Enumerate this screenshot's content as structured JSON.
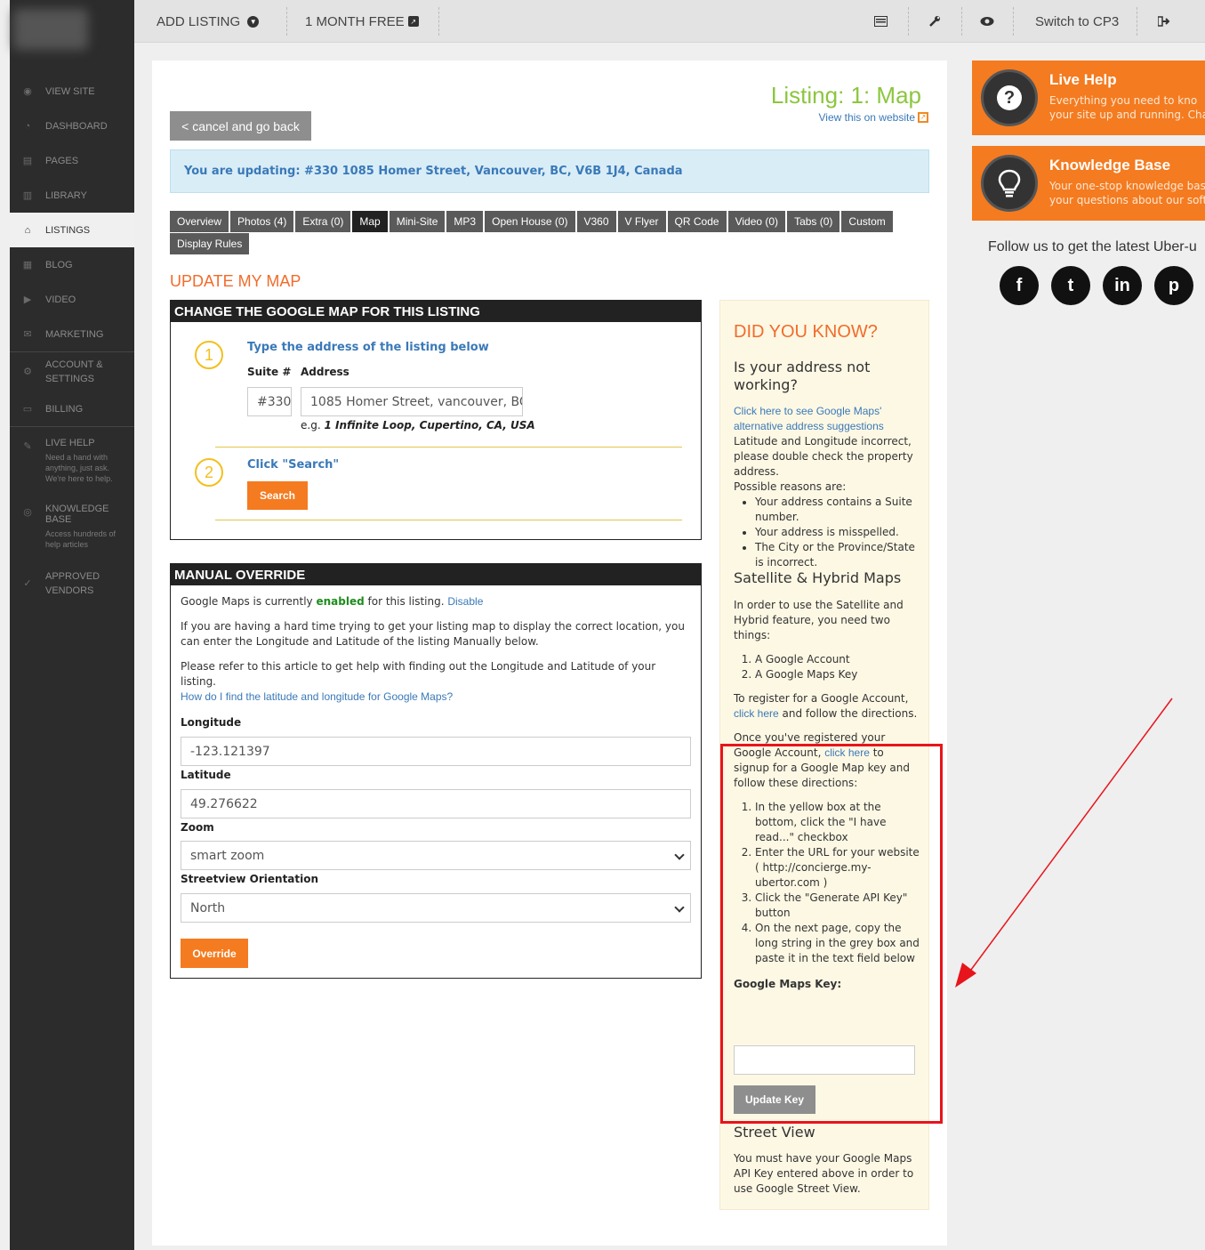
{
  "sidebar": {
    "items": [
      {
        "label": "VIEW SITE",
        "icon": "eye-icon"
      },
      {
        "label": "DASHBOARD",
        "icon": "dashboard-icon"
      },
      {
        "label": "PAGES",
        "icon": "pages-icon"
      },
      {
        "label": "LIBRARY",
        "icon": "library-icon"
      },
      {
        "label": "LISTINGS",
        "icon": "home-icon"
      },
      {
        "label": "BLOG",
        "icon": "blog-icon"
      },
      {
        "label": "VIDEO",
        "icon": "video-icon"
      },
      {
        "label": "MARKETING",
        "icon": "marketing-icon"
      },
      {
        "label": "ACCOUNT & SETTINGS",
        "icon": "settings-icon"
      },
      {
        "label": "BILLING",
        "icon": "billing-icon"
      }
    ],
    "live_help": {
      "label": "LIVE HELP",
      "sub": "Need a hand with anything, just ask. We're here to help."
    },
    "knowledge_base": {
      "label": "KNOWLEDGE BASE",
      "sub": "Access hundreds of help articles"
    },
    "vendors": {
      "label": "APPROVED VENDORS"
    }
  },
  "topbar": {
    "add_listing": "ADD LISTING",
    "month_free": "1 MONTH FREE",
    "switch": "Switch to CP3"
  },
  "main": {
    "title": "Listing: 1: Map",
    "view_site": "View this on website",
    "cancel": "< cancel and go back",
    "alert": "You are updating: #330 1085 Homer Street, Vancouver, BC, V6B 1J4, Canada",
    "tabs": [
      "Overview",
      "Photos (4)",
      "Extra (0)",
      "Map",
      "Mini-Site",
      "MP3",
      "Open House (0)",
      "V360",
      "V Flyer",
      "QR Code",
      "Video (0)",
      "Tabs (0)",
      "Custom",
      "Display Rules"
    ],
    "active_tab": "Map",
    "section_heading": "UPDATE MY MAP"
  },
  "change_map": {
    "heading": "CHANGE THE GOOGLE MAP FOR THIS LISTING",
    "step1_num": "1",
    "step1_title": "Type the address of the listing below",
    "suite_label": "Suite #",
    "address_label": "Address",
    "suite_value": "#330",
    "address_value": "1085 Homer Street, vancouver, BC",
    "hint_prefix": "e.g. ",
    "hint_example": "1 Infinite Loop, Cupertino, CA, USA",
    "step2_num": "2",
    "step2_title": "Click \"Search\"",
    "search_btn": "Search"
  },
  "manual_override": {
    "heading": "MANUAL OVERRIDE",
    "status_prefix": "Google Maps is currently ",
    "status_value": "enabled",
    "status_suffix": " for this listing. ",
    "disable": "Disable",
    "para1": "If you are having a hard time trying to get your listing map to display the correct location, you can enter the Longitude and Latitude of the listing Manually below.",
    "para2": "Please refer to this article to get help with finding out the Longitude and Latitude of your listing.",
    "help_link": "How do I find the latitude and longitude for Google Maps?",
    "longitude_label": "Longitude",
    "longitude_value": "-123.121397",
    "latitude_label": "Latitude",
    "latitude_value": "49.276622",
    "zoom_label": "Zoom",
    "zoom_value": "smart zoom",
    "street_label": "Streetview Orientation",
    "street_value": "North",
    "override_btn": "Override"
  },
  "did_you_know": {
    "title": "DID YOU KNOW?",
    "q1": "Is your address not working?",
    "link1": "Click here to see Google Maps' alternative address suggestions",
    "p1": "Latitude and Longitude incorrect, please double check the property address.",
    "p2": "Possible reasons are:",
    "reasons": [
      "Your address contains a Suite number.",
      "Your address is misspelled.",
      "The City or the Province/State is incorrect."
    ],
    "h2": "Satellite & Hybrid Maps",
    "p3": "In order to use the Satellite and Hybrid feature, you need two things:",
    "things": [
      "A Google Account",
      "A Google Maps Key"
    ],
    "register_prefix": "To register for a Google Account, ",
    "register_link": "click here",
    "register_suffix": " and follow the directions.",
    "once_prefix": "Once you've registered your Google Account, ",
    "once_link": "click here",
    "once_suffix": " to signup for a Google Map key and follow these directions:",
    "directions": [
      "In the yellow box at the bottom, click the \"I have read...\" checkbox",
      "Enter the URL for your website ( http://concierge.my-ubertor.com )",
      "Click the \"Generate API Key\" button",
      "On the next page, copy the long string in the grey box and paste it in the text field below"
    ],
    "key_label": "Google Maps Key:",
    "key_value": "",
    "update_btn": "Update Key",
    "h3": "Street View",
    "p4": "You must have your Google Maps API Key entered above in order to use Google Street View."
  },
  "right": {
    "live_help_title": "Live Help",
    "live_help_text": "Everything you need to kno… your site up and running. Cha…",
    "live_help_line1": "Everything you need to kno",
    "live_help_line2": "your site up and running. Chat",
    "kb_title": "Knowledge Base",
    "kb_line1": "Your one-stop knowledge bas",
    "kb_line2": "your questions about our softw",
    "follow": "Follow us to get the latest Uber-u",
    "social": [
      {
        "name": "facebook-icon",
        "glyph": "f"
      },
      {
        "name": "twitter-icon",
        "glyph": "t"
      },
      {
        "name": "linkedin-icon",
        "glyph": "in"
      },
      {
        "name": "pinterest-icon",
        "glyph": "p"
      }
    ]
  },
  "colors": {
    "accent": "#f47b20",
    "title_green": "#8cc63f",
    "link": "#3a79b8",
    "highlight_red": "#e8141b"
  }
}
